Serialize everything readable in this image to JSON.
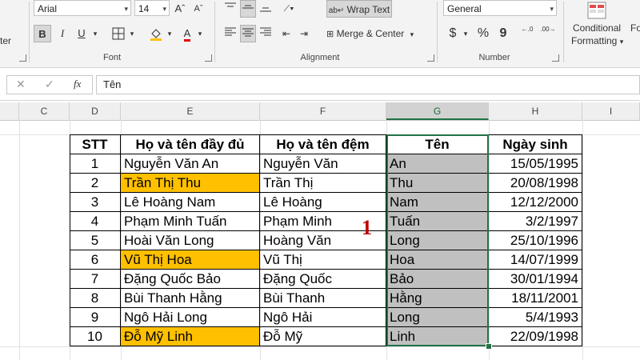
{
  "ribbon": {
    "font_name": "Arial",
    "font_size": "14",
    "wrap_text": "Wrap Text",
    "merge_center": "Merge & Center",
    "number_format": "General",
    "conditional_formatting_line1": "Conditional",
    "conditional_formatting_line2": "Formatting",
    "format_as_table_partial": "Fo",
    "clipboard_partial": "ter",
    "groups": {
      "font": "Font",
      "alignment": "Alignment",
      "number": "Number"
    },
    "bold": "B",
    "italic": "I",
    "underline": "U",
    "font_color_letter": "A",
    "font_grow": "Aˆ",
    "font_shrink": "Aˇ",
    "currency": "$",
    "percent": "%",
    "comma": "9",
    "dec_inc": "←.0",
    "dec_dec": ".00→"
  },
  "formula_bar": {
    "fx_label": "fx",
    "content": "Tên",
    "cancel_glyph": "✕",
    "enter_glyph": "✓"
  },
  "columns": [
    "C",
    "D",
    "E",
    "F",
    "G",
    "H",
    "I"
  ],
  "active_column": "G",
  "table": {
    "headers": [
      "STT",
      "Họ và tên đầy đủ",
      "Họ và tên đệm",
      "Tên",
      "Ngày sinh"
    ],
    "rows": [
      {
        "stt": "1",
        "full": "Nguyễn Văn An",
        "middle": "Nguyễn Văn",
        "first": "An",
        "dob": "15/05/1995",
        "highlight": false
      },
      {
        "stt": "2",
        "full": "Trần Thị Thu",
        "middle": "Trần Thị",
        "first": "Thu",
        "dob": "20/08/1998",
        "highlight": true
      },
      {
        "stt": "3",
        "full": "Lê Hoàng Nam",
        "middle": "Lê Hoàng",
        "first": "Nam",
        "dob": "12/12/2000",
        "highlight": false
      },
      {
        "stt": "4",
        "full": "Phạm Minh Tuấn",
        "middle": "Phạm Minh",
        "first": "Tuấn",
        "dob": "3/2/1997",
        "highlight": false
      },
      {
        "stt": "5",
        "full": "Hoài Văn Long",
        "middle": "Hoàng Văn",
        "first": "Long",
        "dob": "25/10/1996",
        "highlight": false
      },
      {
        "stt": "6",
        "full": "Vũ Thị Hoa",
        "middle": "Vũ Thị",
        "first": "Hoa",
        "dob": "14/07/1999",
        "highlight": true
      },
      {
        "stt": "7",
        "full": "Đặng Quốc Bảo",
        "middle": "Đặng Quốc",
        "first": "Bảo",
        "dob": "30/01/1994",
        "highlight": false
      },
      {
        "stt": "8",
        "full": "Bùi Thanh Hằng",
        "middle": "Bùi Thanh",
        "first": "Hằng",
        "dob": "18/11/2001",
        "highlight": false
      },
      {
        "stt": "9",
        "full": "Ngô Hải Long",
        "middle": "Ngô Hải",
        "first": "Long",
        "dob": "5/4/1993",
        "highlight": false
      },
      {
        "stt": "10",
        "full": "Đỗ Mỹ Linh",
        "middle": "Đỗ Mỹ",
        "first": "Linh",
        "dob": "22/09/1998",
        "highlight": true
      }
    ]
  },
  "annotation_marker": "1",
  "colors": {
    "highlight": "#ffc000",
    "selection_fill": "#c0c0c0",
    "selection_border": "#217346",
    "annotation": "#c00000"
  }
}
